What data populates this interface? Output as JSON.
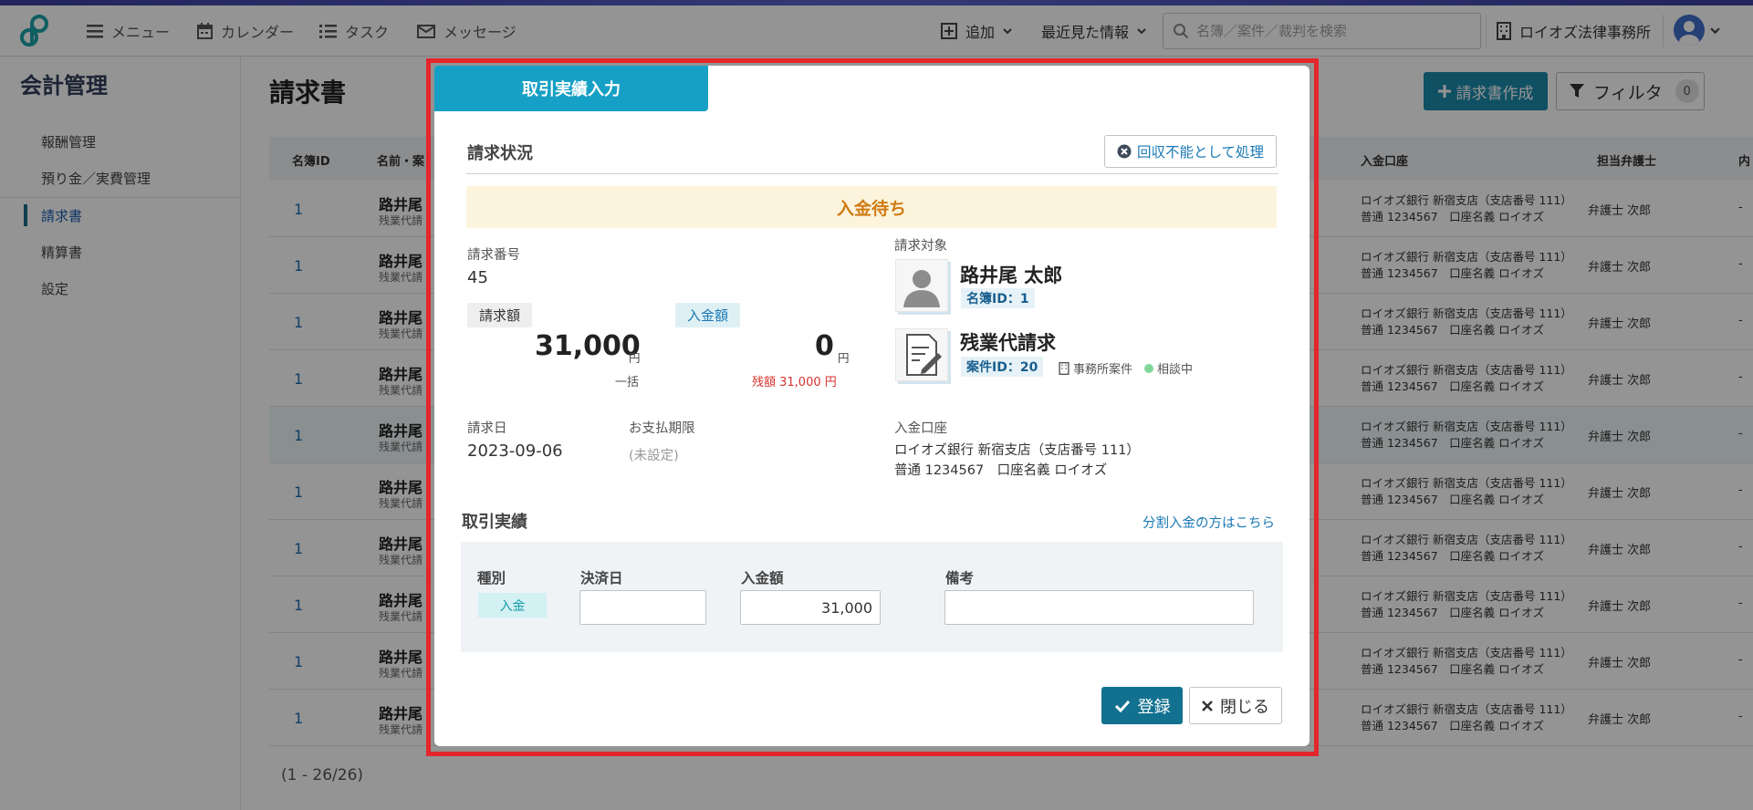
{
  "topbar": {
    "nav": [
      {
        "label": "メニュー",
        "icon": "menu-icon"
      },
      {
        "label": "カレンダー",
        "icon": "calendar-icon"
      },
      {
        "label": "タスク",
        "icon": "task-list-icon"
      },
      {
        "label": "メッセージ",
        "icon": "mail-icon"
      }
    ],
    "add_label": "追加",
    "recent_label": "最近見た情報",
    "search_placeholder": "名簿／案件／裁判を検索",
    "office_name": "ロイオズ法律事務所"
  },
  "sidebar": {
    "title": "会計管理",
    "items": [
      {
        "label": "報酬管理"
      },
      {
        "label": "預り金／実費管理"
      },
      {
        "label": "請求書"
      },
      {
        "label": "精算書"
      },
      {
        "label": "設定"
      }
    ]
  },
  "main": {
    "title": "請求書",
    "create_button": "請求書作成",
    "filter_button": "フィルタ",
    "filter_count": "0",
    "columns": {
      "id": "名簿ID",
      "name": "名前・案",
      "bank": "入金口座",
      "lawyer": "担当弁護士",
      "last": "内"
    },
    "rows": [
      {
        "id": "1",
        "name": "路井尾",
        "sub": "残業代請",
        "bank1": "ロイオズ銀行 新宿支店（支店番号 111）",
        "bank2": "普通 1234567　口座名義 ロイオズ",
        "lawyer": "弁護士 次郎",
        "dash": "-"
      },
      {
        "id": "1",
        "name": "路井尾",
        "sub": "残業代請",
        "bank1": "ロイオズ銀行 新宿支店（支店番号 111）",
        "bank2": "普通 1234567　口座名義 ロイオズ",
        "lawyer": "弁護士 次郎",
        "dash": "-"
      },
      {
        "id": "1",
        "name": "路井尾",
        "sub": "残業代請",
        "bank1": "ロイオズ銀行 新宿支店（支店番号 111）",
        "bank2": "普通 1234567　口座名義 ロイオズ",
        "lawyer": "弁護士 次郎",
        "dash": "-"
      },
      {
        "id": "1",
        "name": "路井尾",
        "sub": "残業代請",
        "bank1": "ロイオズ銀行 新宿支店（支店番号 111）",
        "bank2": "普通 1234567　口座名義 ロイオズ",
        "lawyer": "弁護士 次郎",
        "dash": "-"
      },
      {
        "id": "1",
        "name": "路井尾",
        "sub": "残業代請",
        "bank1": "ロイオズ銀行 新宿支店（支店番号 111）",
        "bank2": "普通 1234567　口座名義 ロイオズ",
        "lawyer": "弁護士 次郎",
        "dash": "-"
      },
      {
        "id": "1",
        "name": "路井尾",
        "sub": "残業代請",
        "bank1": "ロイオズ銀行 新宿支店（支店番号 111）",
        "bank2": "普通 1234567　口座名義 ロイオズ",
        "lawyer": "弁護士 次郎",
        "dash": "-"
      },
      {
        "id": "1",
        "name": "路井尾",
        "sub": "残業代請",
        "bank1": "ロイオズ銀行 新宿支店（支店番号 111）",
        "bank2": "普通 1234567　口座名義 ロイオズ",
        "lawyer": "弁護士 次郎",
        "dash": "-"
      },
      {
        "id": "1",
        "name": "路井尾",
        "sub": "残業代請",
        "bank1": "ロイオズ銀行 新宿支店（支店番号 111）",
        "bank2": "普通 1234567　口座名義 ロイオズ",
        "lawyer": "弁護士 次郎",
        "dash": "-"
      },
      {
        "id": "1",
        "name": "路井尾",
        "sub": "残業代請",
        "bank1": "ロイオズ銀行 新宿支店（支店番号 111）",
        "bank2": "普通 1234567　口座名義 ロイオズ",
        "lawyer": "弁護士 次郎",
        "dash": "-"
      },
      {
        "id": "1",
        "name": "路井尾",
        "sub": "残業代請",
        "bank1": "ロイオズ銀行 新宿支店（支店番号 111）",
        "bank2": "普通 1234567　口座名義 ロイオズ",
        "lawyer": "弁護士 次郎",
        "dash": "-"
      }
    ],
    "page_count": "(1 - 26/26)"
  },
  "modal": {
    "tab_title": "取引実績入力",
    "status_section": "請求状況",
    "noncollect_button": "回収不能として処理",
    "status_banner": "入金待ち",
    "invoice_no_label": "請求番号",
    "invoice_no": "45",
    "billed_label": "請求額",
    "billed_amount": "31,000",
    "yen": "円",
    "payment_type": "一括",
    "received_label": "入金額",
    "received_amount": "0",
    "balance_text": "残額 31,000 円",
    "invoice_date_label": "請求日",
    "invoice_date": "2023-09-06",
    "due_label": "お支払期限",
    "due_value": "(未設定)",
    "target_label": "請求対象",
    "person_name": "路井尾 太郎",
    "person_id": "名簿ID：1",
    "case_name": "残業代請求",
    "case_id": "案件ID：20",
    "case_type": "事務所案件",
    "case_status": "相談中",
    "account_label": "入金口座",
    "account_line1": "ロイオズ銀行 新宿支店（支店番号 111）",
    "account_line2": "普通 1234567　口座名義 ロイオズ",
    "tx_section": "取引実績",
    "split_link": "分割入金の方はこちら",
    "col_kind": "種別",
    "col_date": "決済日",
    "col_amount": "入金額",
    "col_note": "備考",
    "kind_value": "入金",
    "amount_value": "31,000",
    "save_button": "登録",
    "close_button": "閉じる"
  },
  "colors": {
    "accent": "#17a0c5",
    "save": "#12718f",
    "highlight": "#e3262b",
    "status_text": "#d07b15"
  }
}
